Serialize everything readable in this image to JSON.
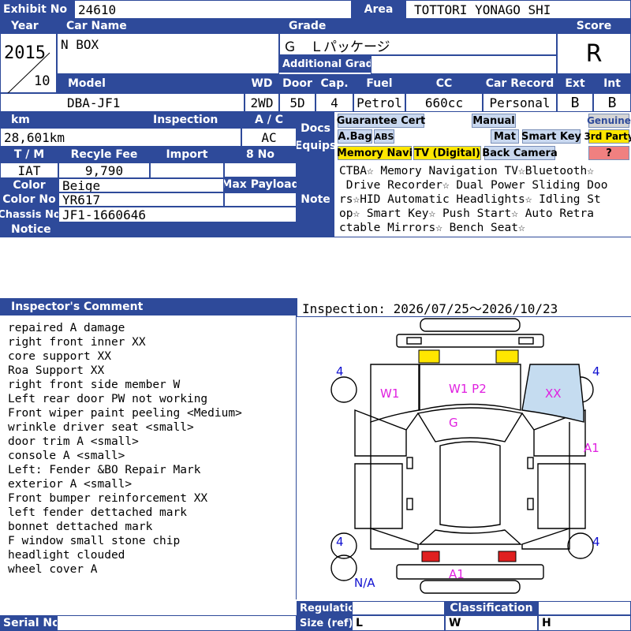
{
  "labels": {
    "exhibit_no": "Exhibit No",
    "area": "Area",
    "year": "Year",
    "car_name": "Car Name",
    "grade": "Grade",
    "score": "Score",
    "additional_grade": "Additional Grade",
    "model": "Model",
    "wd": "WD",
    "door": "Door",
    "cap": "Cap.",
    "fuel": "Fuel",
    "cc": "CC",
    "car_record": "Car Record",
    "ext": "Ext",
    "int": "Int",
    "km": "km",
    "inspection": "Inspection",
    "ac": "A / C",
    "docs_equips": "Docs Equips",
    "tm": "T / M",
    "recycle_fee": "Recyle Fee",
    "import": "Import",
    "eight_no": "8 No",
    "color": "Color",
    "max_payload": "Max Payload",
    "note": "Note",
    "color_no": "Color No",
    "chassis_no": "Chassis No",
    "notice": "Notice",
    "inspectors_comment": "Inspector's Comment",
    "regulation": "Regulation",
    "classification": "Classification",
    "size_ref": "Size (ref)",
    "serial_no": "Serial No",
    "size_l": "L",
    "size_w": "W",
    "size_h": "H"
  },
  "vehicle": {
    "exhibit_no": "24610",
    "area": "TOTTORI YONAGO SHI",
    "year": "2015",
    "month": "10",
    "car_name": "N BOX",
    "grade": "Ｇ　Ｌパッケージ",
    "score": "R",
    "model": "DBA-JF1",
    "wd": "2WD",
    "door": "5D",
    "cap": "4",
    "fuel": "Petrol",
    "cc": "660cc",
    "car_record": "Personal",
    "ext": "B",
    "int": "B",
    "km": "28,601km",
    "ac": "AC",
    "tm": "IAT",
    "recycle_fee": "9,790",
    "color": "Beige",
    "color_no": "YR617",
    "chassis_no": "JF1-1660646"
  },
  "equips": {
    "guarantee_cert": "Guarantee Cert",
    "manual": "Manual",
    "genuine": "Genuine",
    "abag": "A.Bag",
    "abs": "ABS",
    "mat": "Mat",
    "smart_key": "Smart Key",
    "third_party": "3rd Party",
    "memory_navi": "Memory Navi",
    "tv_digital": "TV (Digital)",
    "back_camera": "Back Camera",
    "question": "?"
  },
  "note_lines": [
    "CTBA☆ Memory Navigation TV☆Bluetooth☆",
    " Drive Recorder☆ Dual Power Sliding Doo",
    "rs☆HID Automatic Headlights☆ Idling St",
    "op☆ Smart Key☆ Push Start☆ Auto Retra",
    "ctable Mirrors☆ Bench Seat☆"
  ],
  "inspection_period": "Inspection: 2026/07/25～2026/10/23",
  "comments": [
    "repaired A damage",
    "right front inner XX",
    "core support XX",
    "Roa Support XX",
    "right front side member W",
    "Left rear door PW not working",
    "Front wiper paint peeling <Medium>",
    "wrinkle driver seat <small>",
    "door trim A <small>",
    "console A <small>",
    "Left: Fender &BO Repair Mark",
    "exterior A <small>",
    "Front bumper reinforcement XX",
    "left fender dettached mark",
    "bonnet dettached mark",
    "F window small stone chip",
    "headlight clouded",
    "wheel cover A"
  ],
  "diagram_marks": {
    "w1_left": "W1",
    "w1p2": "W1  P2",
    "xx": "XX",
    "g": "G",
    "a1_right": "A1",
    "a1_rear": "A1",
    "tyre_fl": "4",
    "tyre_fr": "4",
    "tyre_rl": "4",
    "tyre_rr": "4",
    "spare": "N/A"
  },
  "colors": {
    "header": "#2e4a9a",
    "damage_mark": "#e020e0",
    "tyre_mark": "#1010d0",
    "highlight_yellow": "#ffe600",
    "highlight_blue": "#c9d8ef",
    "damage_area": "#c5dcf0",
    "taillight_red": "#e02020"
  }
}
